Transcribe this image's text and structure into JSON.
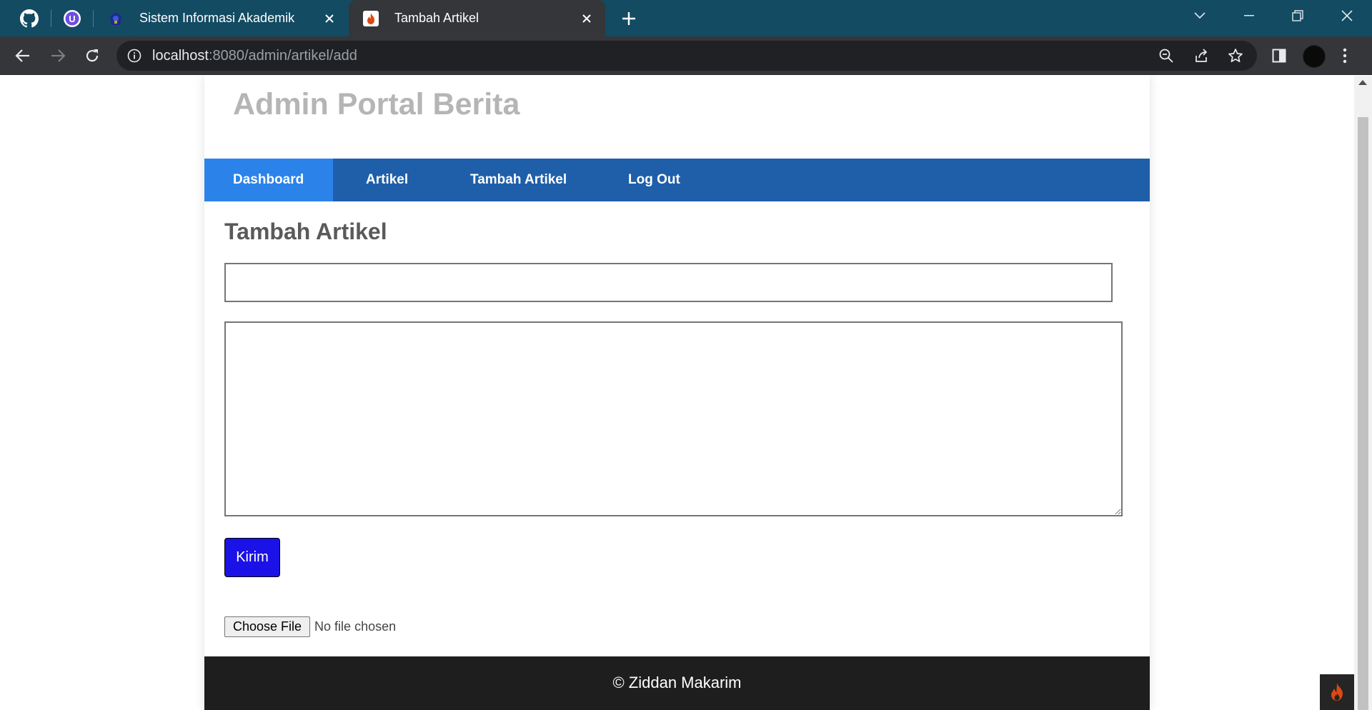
{
  "browser": {
    "tabs": [
      {
        "title": "Sistem Informasi Akademik",
        "favicon": "university-logo-icon",
        "active": false
      },
      {
        "title": "Tambah Artikel",
        "favicon": "codeigniter-flame-icon",
        "active": true
      }
    ],
    "url_host": "localhost",
    "url_rest": ":8080/admin/artikel/add"
  },
  "site": {
    "title": "Admin Portal Berita",
    "nav": [
      {
        "label": "Dashboard",
        "active": true
      },
      {
        "label": "Artikel",
        "active": false
      },
      {
        "label": "Tambah Artikel",
        "active": false
      },
      {
        "label": "Log Out",
        "active": false
      }
    ]
  },
  "form": {
    "heading": "Tambah Artikel",
    "title_value": "",
    "body_value": "",
    "submit_label": "Kirim",
    "file_button_label": "Choose File",
    "file_status": "No file chosen"
  },
  "footer": {
    "text": "© Ziddan Makarim"
  },
  "colors": {
    "navbar": "#1f5faa",
    "nav_active": "#2b83ea",
    "submit_button": "#1a12e6",
    "footer": "#1e1e1e",
    "tabbar": "#134b63"
  }
}
